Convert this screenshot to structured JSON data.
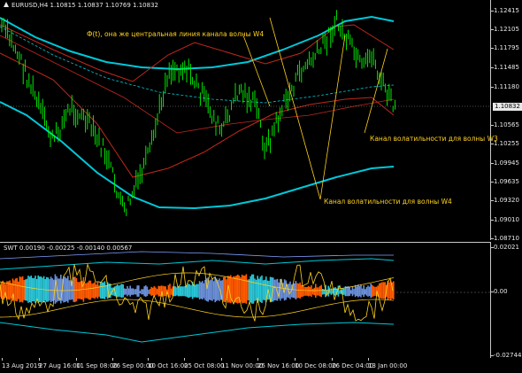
{
  "chart": {
    "symbol_line": "EURUSD,H4  1.10815 1.10837 1.10769 1.10832",
    "indicator_line": "SWT 0.00190 -0.00225 -0.00140 0.00567",
    "current_price": "1.10832",
    "price_ticks": [
      "1.12415",
      "1.12105",
      "1.11795",
      "1.11485",
      "1.11180",
      "1.10870",
      "1.10565",
      "1.10255",
      "1.09945",
      "1.09635",
      "1.09320",
      "1.09010",
      "1.08710"
    ],
    "indicator_ticks": [
      "0.02021",
      "0.00",
      "-0.02744"
    ],
    "time_labels": [
      "13 Aug 2019",
      "27 Aug 16:00",
      "11 Sep 08:00",
      "26 Sep 00:00",
      "10 Oct 16:00",
      "25 Oct 08:00",
      "11 Nov 00:00",
      "25 Nov 16:00",
      "10 Dec 08:00",
      "26 Dec 04:00",
      "13 Jan 00:00"
    ],
    "annotations": {
      "center_line": "Ф(t), она же центральная линия канала волны W4",
      "channel_w3": "Канал волатильности для волны W3",
      "channel_w4": "Канал волатильности для волны W4"
    },
    "colors": {
      "candles": "#00ff00",
      "upper_band": "#00c8d8",
      "channel_red": "#c0281c",
      "annotation": "#ffd21f",
      "background": "#000000",
      "indicator_cyan": "#29c5d6",
      "indicator_orange": "#ff5a00",
      "indicator_blue": "#6a8fd8"
    }
  }
}
